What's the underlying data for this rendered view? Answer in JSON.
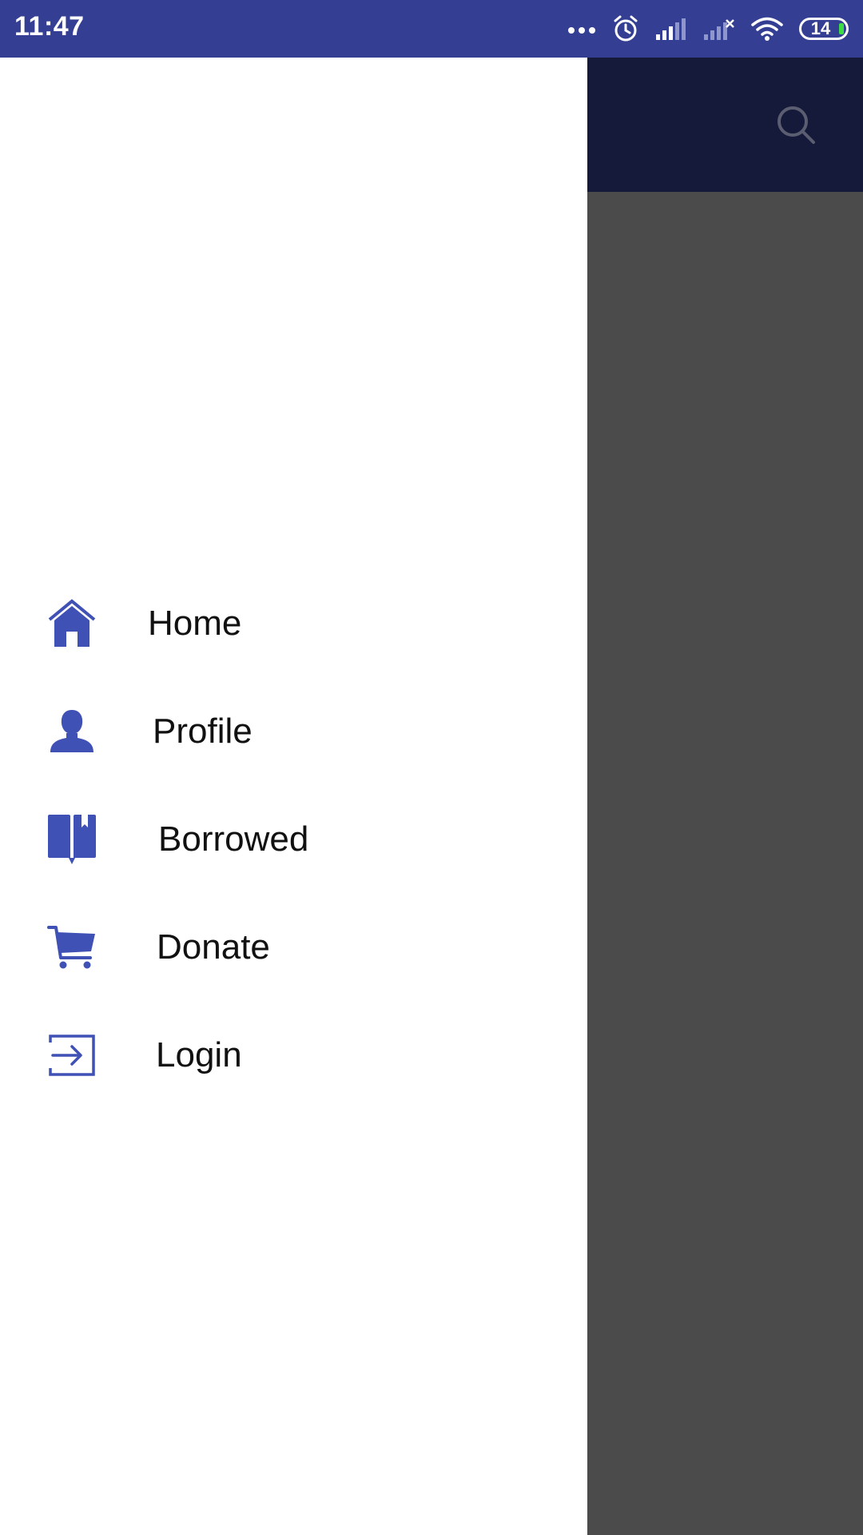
{
  "status_bar": {
    "time": "11:47",
    "battery_level": "14",
    "icons": [
      "more-dots-icon",
      "alarm-icon",
      "signal-icon",
      "signal-no-sim-icon",
      "wifi-icon",
      "battery-icon"
    ]
  },
  "app_bar": {
    "icons": [
      "search-icon"
    ]
  },
  "drawer": {
    "items": [
      {
        "label": "Home",
        "icon": "home-icon"
      },
      {
        "label": "Profile",
        "icon": "person-icon"
      },
      {
        "label": "Borrowed",
        "icon": "book-icon"
      },
      {
        "label": "Donate",
        "icon": "cart-icon"
      },
      {
        "label": "Login",
        "icon": "login-icon"
      }
    ]
  },
  "colors": {
    "status_bar": "#343f94",
    "app_bar_dimmed": "#15193a",
    "scrim": "#4b4b4b",
    "accent_icon": "#3f51b5",
    "drawer_bg": "#ffffff",
    "label_text": "#111111"
  }
}
